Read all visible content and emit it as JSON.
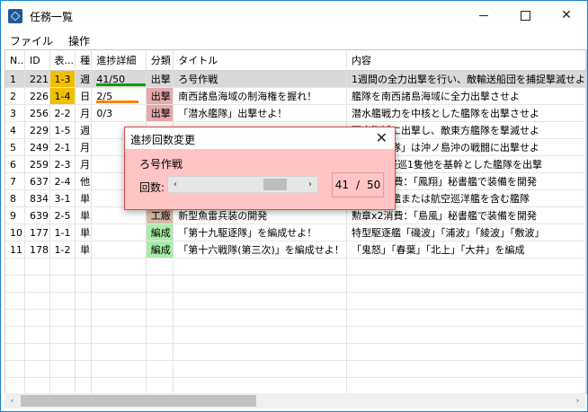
{
  "window": {
    "title": "任務一覧",
    "min_glyph": "—",
    "max_glyph": "☐",
    "close_glyph": "✕"
  },
  "menu": [
    "ファイル",
    "操作"
  ],
  "table": {
    "columns": [
      "N..",
      "ID",
      "表...",
      "種",
      "進捗詳細",
      "分類",
      "タイトル",
      "内容"
    ],
    "rows": [
      {
        "n": "1",
        "id": "221",
        "area": "1-3",
        "type": "週",
        "progress": "41/50",
        "category": "出撃",
        "title": "ろ号作戦",
        "content": "1週間の全力出撃を行い、敵輸送船団を捕捉撃滅せよ",
        "highlight": true,
        "progress_fraction": 0.82,
        "bar_color": "#00a000"
      },
      {
        "n": "2",
        "id": "226",
        "area": "1-4",
        "type": "日",
        "progress": "2/5",
        "category": "出撃",
        "title": "南西諸島海域の制海権を握れ！",
        "content": "艦隊を南西諸島海域に全力出撃させよ",
        "highlight": true,
        "progress_fraction": 0.4,
        "bar_color": "#ff8000"
      },
      {
        "n": "3",
        "id": "256",
        "area": "2-2",
        "type": "月",
        "progress": "0/3",
        "category": "出撃",
        "title": "「潜水艦隊」出撃せよ！",
        "content": "潜水艦戦力を中核とした艦隊を出撃させよ"
      },
      {
        "n": "4",
        "id": "229",
        "area": "1-5",
        "type": "週",
        "progress": "",
        "category": "",
        "title": "",
        "content": "西方海域に出撃し、敵東方艦隊を撃滅せよ"
      },
      {
        "n": "5",
        "id": "249",
        "area": "2-1",
        "type": "月",
        "progress": "",
        "category": "",
        "title": "",
        "content": "「第五戦隊」は沖ノ島沖の戦闘に出撃せよ"
      },
      {
        "n": "6",
        "id": "259",
        "area": "2-3",
        "type": "月",
        "progress": "",
        "category": "",
        "title": "",
        "content": "戦艦3隻軽巡1隻他を基幹とした艦隊を出撃"
      },
      {
        "n": "7",
        "id": "637",
        "area": "2-4",
        "type": "他",
        "progress": "",
        "category": "",
        "title": "",
        "content": "勲章x2消費：「鳳翔」秘書艦で装備を開発"
      },
      {
        "n": "8",
        "id": "834",
        "area": "3-1",
        "type": "単",
        "progress": "",
        "category": "",
        "title": "！",
        "content": "水上機母艦または航空巡洋艦を含む艦隊"
      },
      {
        "n": "9",
        "id": "639",
        "area": "2-5",
        "type": "単",
        "progress": "",
        "category": "工廠",
        "title": "新型魚雷兵装の開発",
        "content": "勲章x2消費：「島風」秘書艦で装備を開発"
      },
      {
        "n": "10",
        "id": "177",
        "area": "1-1",
        "type": "単",
        "progress": "",
        "category": "編成",
        "title": "「第十九駆逐隊」を編成せよ！",
        "content": "特型駆逐艦「磯波」「浦波」「綾波」「敷波」"
      },
      {
        "n": "11",
        "id": "178",
        "area": "1-2",
        "type": "単",
        "progress": "",
        "category": "編成",
        "title": "「第十六戦隊(第三次)」を編成せよ！",
        "content": "「鬼怒」「春葉」「北上」「大井」を編成"
      }
    ]
  },
  "dialog": {
    "title": "進捗回数変更",
    "close_glyph": "✕",
    "quest_name": "ろ号作戦",
    "count_label": "回数:",
    "slider_left": "‹",
    "slider_right": "›",
    "current": "41",
    "separator": "/",
    "max": "50",
    "slider_fraction": 0.82
  },
  "scrollbar": {
    "left": "‹",
    "right": "›",
    "thumb_fraction": 0.43
  }
}
